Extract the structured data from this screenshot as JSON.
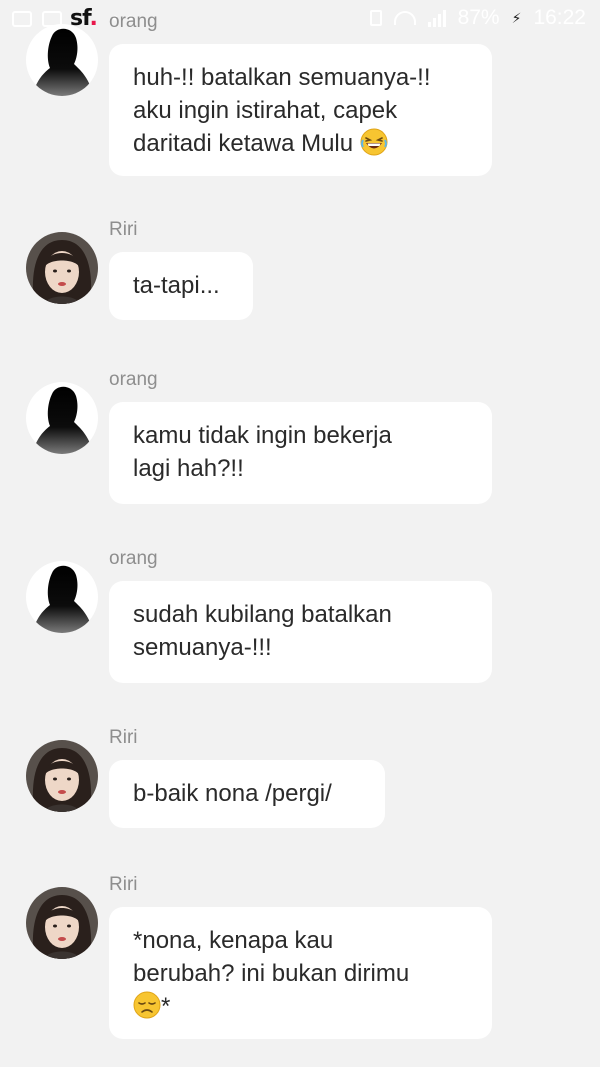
{
  "status_bar": {
    "battery": "87%",
    "time": "16:22"
  },
  "app": {
    "logo_text": "sf"
  },
  "messages": [
    {
      "sender": "orang",
      "avatar": "silhouette",
      "text": "huh-!! batalkan semuanya-!!\naku ingin istirahat, capek\ndaritadi ketawa Mulu",
      "emoji": "laughing-emoji"
    },
    {
      "sender": "Riri",
      "avatar": "girl-photo",
      "text": "ta-tapi..."
    },
    {
      "sender": "orang",
      "avatar": "silhouette",
      "text": "kamu tidak ingin bekerja\nlagi hah?!!"
    },
    {
      "sender": "orang",
      "avatar": "silhouette",
      "text": "sudah kubilang batalkan\nsemuanya-!!!"
    },
    {
      "sender": "Riri",
      "avatar": "girl-photo",
      "text": "b-baik nona /pergi/"
    },
    {
      "sender": "Riri",
      "avatar": "girl-photo",
      "text": "*nona, kenapa kau\nberubah? ini bukan dirimu\n",
      "emoji": "disappointed-emoji",
      "text_after": "*"
    }
  ]
}
